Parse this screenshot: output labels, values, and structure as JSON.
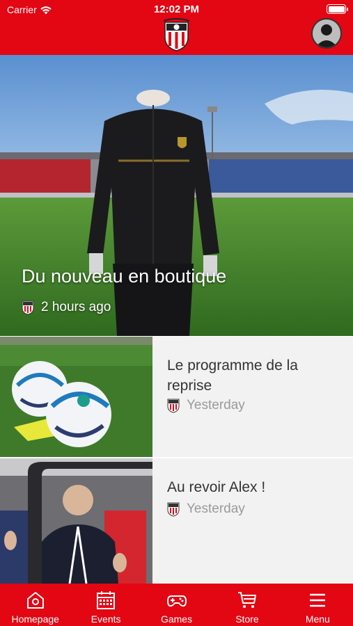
{
  "status_bar": {
    "carrier": "Carrier",
    "time": "12:02 PM"
  },
  "hero": {
    "title": "Du nouveau en boutique",
    "time": "2 hours ago"
  },
  "articles": [
    {
      "title": "Le programme de la reprise",
      "time": "Yesterday"
    },
    {
      "title": "Au revoir Alex !",
      "time": "Yesterday"
    }
  ],
  "tabbar": {
    "items": [
      {
        "label": "Homepage",
        "icon": "home-icon"
      },
      {
        "label": "Events",
        "icon": "calendar-icon"
      },
      {
        "label": "Games",
        "icon": "gamepad-icon"
      },
      {
        "label": "Store",
        "icon": "cart-icon"
      },
      {
        "label": "Menu",
        "icon": "menu-icon"
      }
    ]
  },
  "colors": {
    "brand_red": "#e30613",
    "list_bg": "#f2f2f2",
    "meta_gray": "#9a9a9a"
  }
}
